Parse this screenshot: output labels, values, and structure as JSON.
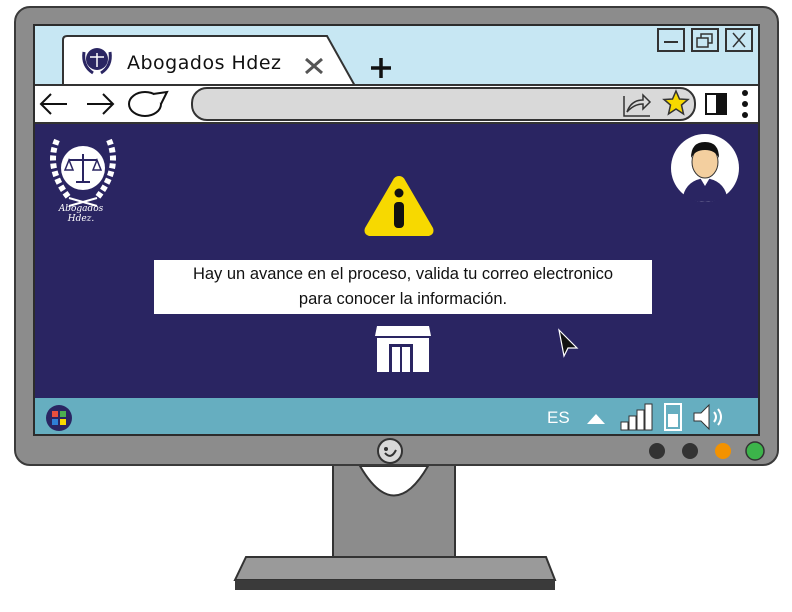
{
  "browser": {
    "tab_title": "Abogados  Hdez",
    "tab_close_icon": "close-icon",
    "new_tab_icon": "plus-icon",
    "window_controls": [
      "minimize-icon",
      "restore-icon",
      "close-window-icon"
    ],
    "nav_icons": [
      "back-arrow-icon",
      "forward-arrow-icon",
      "reload-icon"
    ],
    "address_value": "",
    "address_icons": [
      "share-icon",
      "star-icon"
    ],
    "toolbar_icons": [
      "sidebar-icon",
      "kebab-menu-icon"
    ]
  },
  "page": {
    "logo_caption": "Abogados Hdez.",
    "alert_icon": "warning-info-icon",
    "message_line1": "Hay un avance en el proceso, valida tu correo electronico",
    "message_line2": "para conocer la información.",
    "building_icon": "office-building-icon",
    "avatar_icon": "user-avatar-icon"
  },
  "taskbar": {
    "start_icon": "start-menu-icon",
    "language": "ES",
    "tray_icons": [
      "tray-up-arrow-icon",
      "signal-bars-icon",
      "battery-icon",
      "volume-icon"
    ]
  },
  "colors": {
    "page_background": "#2a2562",
    "titlebar": "#c7e7f3",
    "taskbar": "#66aec0",
    "warning": "#f7d900",
    "monitor_frame": "#8c8c8c",
    "led_dark": "#333333",
    "led_orange": "#f39200",
    "led_green": "#3cb44a"
  }
}
